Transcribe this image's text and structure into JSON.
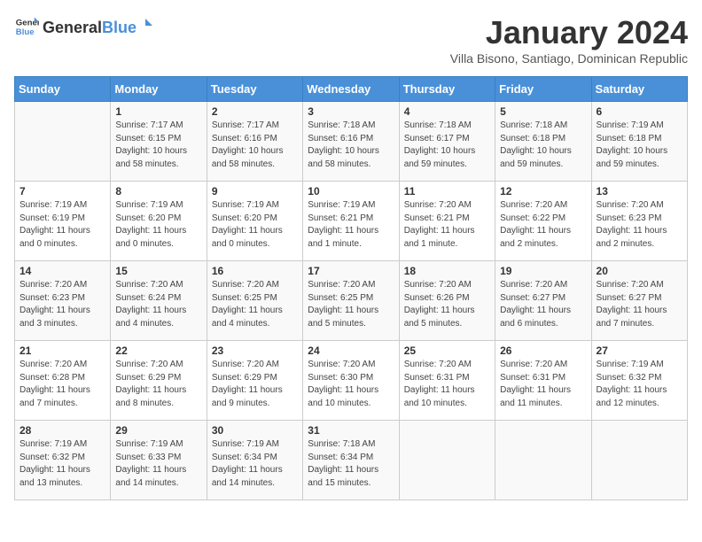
{
  "header": {
    "logo_general": "General",
    "logo_blue": "Blue",
    "month_title": "January 2024",
    "subtitle": "Villa Bisono, Santiago, Dominican Republic"
  },
  "days_of_week": [
    "Sunday",
    "Monday",
    "Tuesday",
    "Wednesday",
    "Thursday",
    "Friday",
    "Saturday"
  ],
  "weeks": [
    [
      {
        "day": "",
        "info": ""
      },
      {
        "day": "1",
        "info": "Sunrise: 7:17 AM\nSunset: 6:15 PM\nDaylight: 10 hours\nand 58 minutes."
      },
      {
        "day": "2",
        "info": "Sunrise: 7:17 AM\nSunset: 6:16 PM\nDaylight: 10 hours\nand 58 minutes."
      },
      {
        "day": "3",
        "info": "Sunrise: 7:18 AM\nSunset: 6:16 PM\nDaylight: 10 hours\nand 58 minutes."
      },
      {
        "day": "4",
        "info": "Sunrise: 7:18 AM\nSunset: 6:17 PM\nDaylight: 10 hours\nand 59 minutes."
      },
      {
        "day": "5",
        "info": "Sunrise: 7:18 AM\nSunset: 6:18 PM\nDaylight: 10 hours\nand 59 minutes."
      },
      {
        "day": "6",
        "info": "Sunrise: 7:19 AM\nSunset: 6:18 PM\nDaylight: 10 hours\nand 59 minutes."
      }
    ],
    [
      {
        "day": "7",
        "info": "Sunrise: 7:19 AM\nSunset: 6:19 PM\nDaylight: 11 hours\nand 0 minutes."
      },
      {
        "day": "8",
        "info": "Sunrise: 7:19 AM\nSunset: 6:20 PM\nDaylight: 11 hours\nand 0 minutes."
      },
      {
        "day": "9",
        "info": "Sunrise: 7:19 AM\nSunset: 6:20 PM\nDaylight: 11 hours\nand 0 minutes."
      },
      {
        "day": "10",
        "info": "Sunrise: 7:19 AM\nSunset: 6:21 PM\nDaylight: 11 hours\nand 1 minute."
      },
      {
        "day": "11",
        "info": "Sunrise: 7:20 AM\nSunset: 6:21 PM\nDaylight: 11 hours\nand 1 minute."
      },
      {
        "day": "12",
        "info": "Sunrise: 7:20 AM\nSunset: 6:22 PM\nDaylight: 11 hours\nand 2 minutes."
      },
      {
        "day": "13",
        "info": "Sunrise: 7:20 AM\nSunset: 6:23 PM\nDaylight: 11 hours\nand 2 minutes."
      }
    ],
    [
      {
        "day": "14",
        "info": "Sunrise: 7:20 AM\nSunset: 6:23 PM\nDaylight: 11 hours\nand 3 minutes."
      },
      {
        "day": "15",
        "info": "Sunrise: 7:20 AM\nSunset: 6:24 PM\nDaylight: 11 hours\nand 4 minutes."
      },
      {
        "day": "16",
        "info": "Sunrise: 7:20 AM\nSunset: 6:25 PM\nDaylight: 11 hours\nand 4 minutes."
      },
      {
        "day": "17",
        "info": "Sunrise: 7:20 AM\nSunset: 6:25 PM\nDaylight: 11 hours\nand 5 minutes."
      },
      {
        "day": "18",
        "info": "Sunrise: 7:20 AM\nSunset: 6:26 PM\nDaylight: 11 hours\nand 5 minutes."
      },
      {
        "day": "19",
        "info": "Sunrise: 7:20 AM\nSunset: 6:27 PM\nDaylight: 11 hours\nand 6 minutes."
      },
      {
        "day": "20",
        "info": "Sunrise: 7:20 AM\nSunset: 6:27 PM\nDaylight: 11 hours\nand 7 minutes."
      }
    ],
    [
      {
        "day": "21",
        "info": "Sunrise: 7:20 AM\nSunset: 6:28 PM\nDaylight: 11 hours\nand 7 minutes."
      },
      {
        "day": "22",
        "info": "Sunrise: 7:20 AM\nSunset: 6:29 PM\nDaylight: 11 hours\nand 8 minutes."
      },
      {
        "day": "23",
        "info": "Sunrise: 7:20 AM\nSunset: 6:29 PM\nDaylight: 11 hours\nand 9 minutes."
      },
      {
        "day": "24",
        "info": "Sunrise: 7:20 AM\nSunset: 6:30 PM\nDaylight: 11 hours\nand 10 minutes."
      },
      {
        "day": "25",
        "info": "Sunrise: 7:20 AM\nSunset: 6:31 PM\nDaylight: 11 hours\nand 10 minutes."
      },
      {
        "day": "26",
        "info": "Sunrise: 7:20 AM\nSunset: 6:31 PM\nDaylight: 11 hours\nand 11 minutes."
      },
      {
        "day": "27",
        "info": "Sunrise: 7:19 AM\nSunset: 6:32 PM\nDaylight: 11 hours\nand 12 minutes."
      }
    ],
    [
      {
        "day": "28",
        "info": "Sunrise: 7:19 AM\nSunset: 6:32 PM\nDaylight: 11 hours\nand 13 minutes."
      },
      {
        "day": "29",
        "info": "Sunrise: 7:19 AM\nSunset: 6:33 PM\nDaylight: 11 hours\nand 14 minutes."
      },
      {
        "day": "30",
        "info": "Sunrise: 7:19 AM\nSunset: 6:34 PM\nDaylight: 11 hours\nand 14 minutes."
      },
      {
        "day": "31",
        "info": "Sunrise: 7:18 AM\nSunset: 6:34 PM\nDaylight: 11 hours\nand 15 minutes."
      },
      {
        "day": "",
        "info": ""
      },
      {
        "day": "",
        "info": ""
      },
      {
        "day": "",
        "info": ""
      }
    ]
  ]
}
